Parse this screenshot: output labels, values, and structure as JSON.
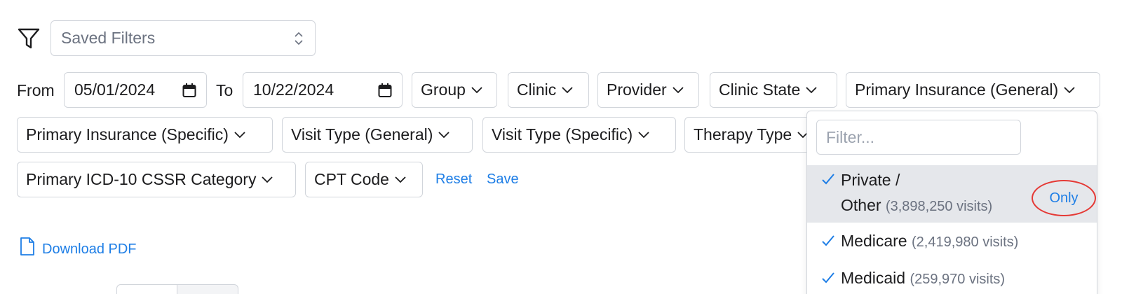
{
  "filters": {
    "saved_filters_placeholder": "Saved Filters",
    "from_label": "From",
    "to_label": "To",
    "from_date": "05/01/2024",
    "to_date": "10/22/2024",
    "dropdowns_row1": [
      "Group",
      "Clinic",
      "Provider",
      "Clinic State",
      "Primary Insurance (General)"
    ],
    "dropdowns_row2": [
      "Primary Insurance (Specific)",
      "Visit Type (General)",
      "Visit Type (Specific)",
      "Therapy Type"
    ],
    "dropdowns_row3": [
      "Primary ICD-10 CSSR Category",
      "CPT Code"
    ],
    "reset_label": "Reset",
    "save_label": "Save"
  },
  "download": {
    "label": "Download PDF"
  },
  "insurance_popup": {
    "filter_placeholder": "Filter...",
    "only_label": "Only",
    "options": [
      {
        "name_line1": "Private /",
        "name_line2": "Other",
        "count": "(3,898,250 visits)",
        "checked": true,
        "highlighted": true
      },
      {
        "name": "Medicare",
        "count": "(2,419,980 visits)",
        "checked": true
      },
      {
        "name": "Medicaid",
        "count": "(259,970 visits)",
        "checked": true
      }
    ]
  },
  "colors": {
    "accent": "#1e7ee6",
    "highlight_ring": "#e53935",
    "border": "#d1d5db",
    "selected_row_bg": "#e5e7eb"
  },
  "icons": [
    "funnel-icon",
    "up-down-chevron-icon",
    "calendar-icon",
    "chevron-down-icon",
    "document-icon",
    "checkmark-icon"
  ]
}
